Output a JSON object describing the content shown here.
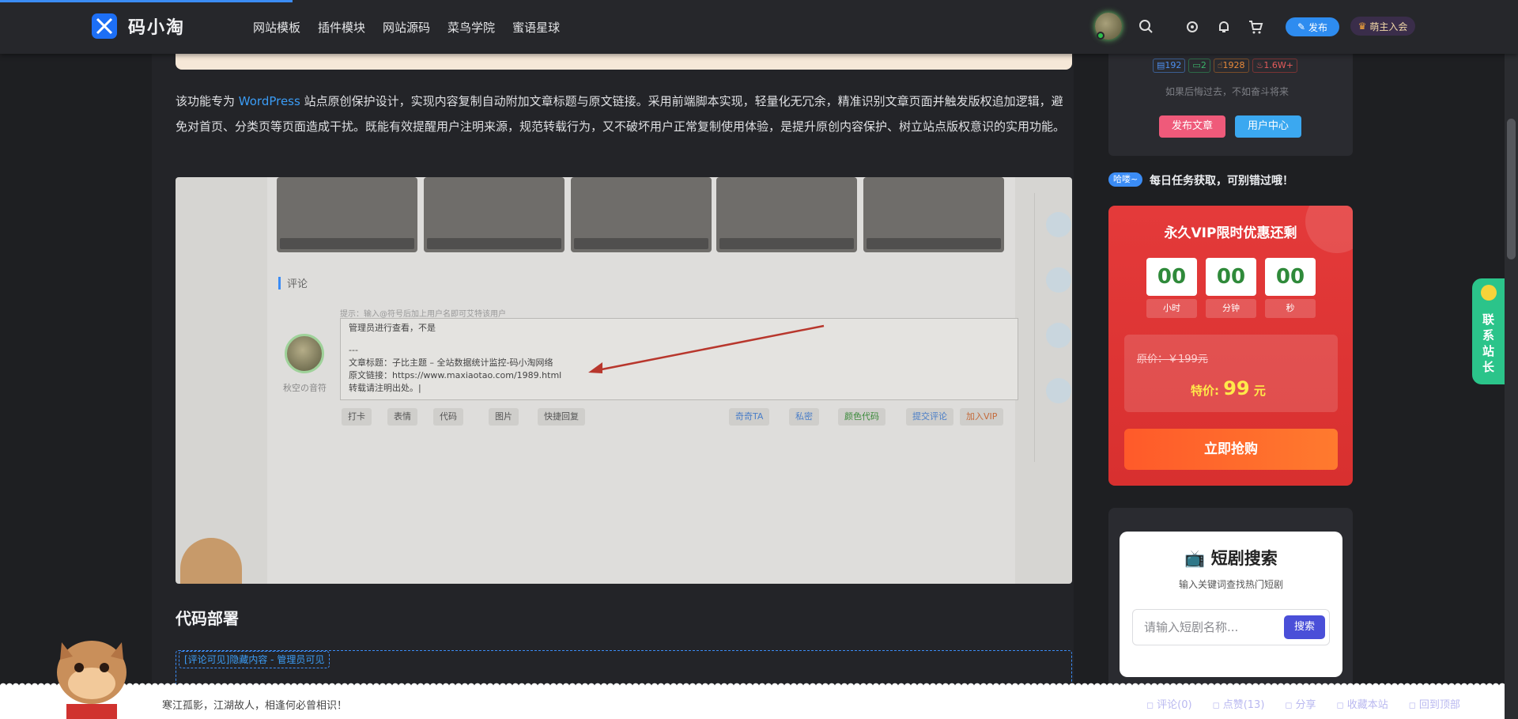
{
  "header": {
    "brand": "码小淘",
    "nav": [
      "网站模板",
      "插件模块",
      "网站源码",
      "菜鸟学院",
      "蜜语星球"
    ],
    "publish_label": "发布",
    "vip_label": "萌主入会"
  },
  "article": {
    "paragraph_pre": "该功能专为 ",
    "paragraph_link": "WordPress",
    "paragraph_post": " 站点原创保护设计，实现内容复制自动附加文章标题与原文链接。采用前端脚本实现，轻量化无冗余，精准识别文章页面并触发版权追加逻辑，避免对首页、分类页等页面造成干扰。既能有效提醒用户注明来源，规范转载行为，又不破坏用户正常复制使用体验，是提升原创内容保护、树立站点版权意识的实用功能。",
    "screenshot": {
      "section_label": "评论",
      "hint": "提示：输入@符号后加上用户名即可艾特该用户",
      "comment_lines": [
        "管理员进行查看，不是",
        "",
        "---",
        "文章标题：子比主题 – 全站数据统计监控-码小淘网络",
        "原文链接：https://www.maxiaotao.com/1989.html",
        "转载请注明出处。|"
      ],
      "user_name": "秋空の音符",
      "tools": [
        "打卡",
        "表情",
        "代码",
        "图片",
        "快捷回复"
      ],
      "actions": [
        "奇奇TA",
        "私密",
        "颜色代码",
        "提交评论",
        "加入VIP"
      ]
    },
    "deploy_title": "代码部署",
    "hidden_tag": "[评论可见]隐藏内容 - 管理员可见"
  },
  "sidebar": {
    "stats": [
      "192",
      "2",
      "1928",
      "1.6W+"
    ],
    "motto": "如果后悔过去，不如奋斗将来",
    "publish_article": "发布文章",
    "user_center": "用户中心",
    "daily_tag": "哈喽~",
    "daily_text": "每日任务获取，可别错过哦！",
    "vip": {
      "title": "永久VIP限时优惠还剩",
      "hours": "00",
      "minutes": "00",
      "seconds": "00",
      "hours_label": "小时",
      "minutes_label": "分钟",
      "seconds_label": "秒",
      "original_price": "原价：￥199元",
      "sale_label": "特价:",
      "sale_price": "99",
      "sale_unit": "元",
      "buy_label": "立即抢购"
    },
    "drama": {
      "title": "短剧搜索",
      "subtitle": "输入关键词查找热门短剧",
      "placeholder": "请输入短剧名称...",
      "search_label": "搜索"
    }
  },
  "float_contact": "联系站长",
  "footer": {
    "text": "寒江孤影，江湖故人，相逢何必曾相识！",
    "links": [
      "评论(0)",
      "点赞(13)",
      "分享",
      "收藏本站",
      "回到顶部"
    ]
  },
  "colors": {
    "accent": "#3b8cf5",
    "vip_red": "#e43a3a",
    "contact_green": "#2bc48a"
  }
}
